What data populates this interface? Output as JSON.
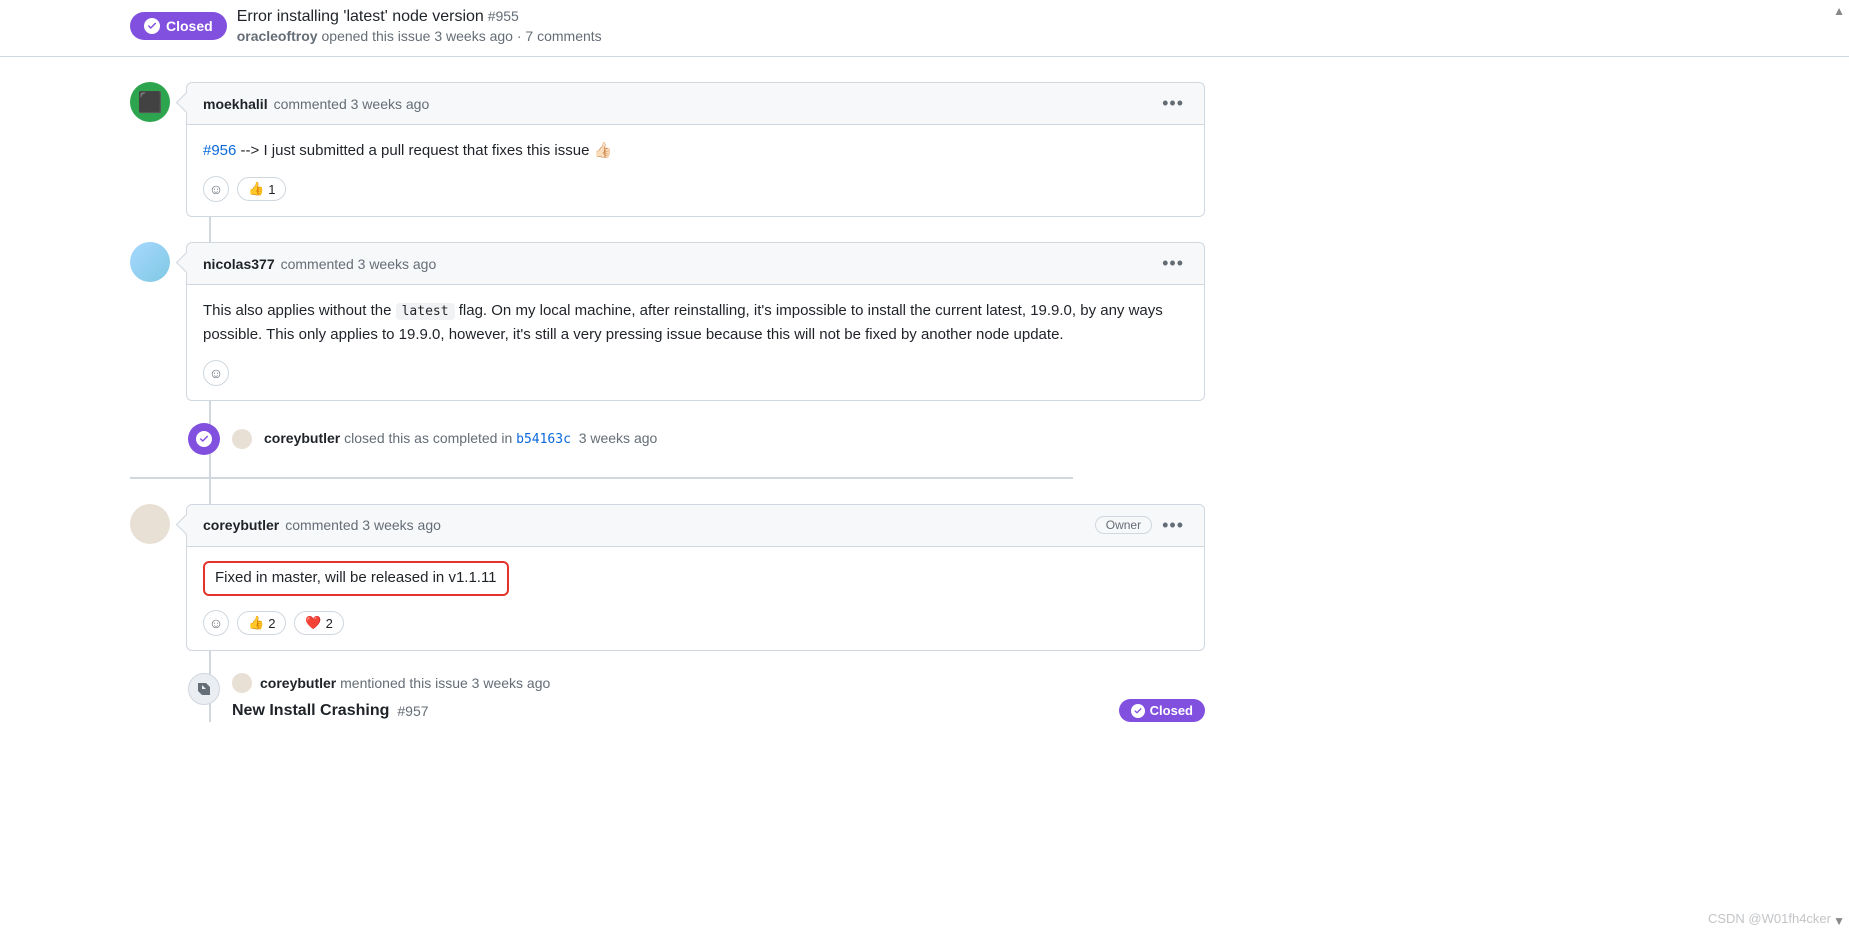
{
  "header": {
    "status": "Closed",
    "title": "Error installing 'latest' node version",
    "number": "#955",
    "author": "oracleoftroy",
    "action": "opened this issue",
    "time": "3 weeks ago",
    "sep": "·",
    "commentcount": "7 comments"
  },
  "comments": [
    {
      "user": "moekhalil",
      "meta": "commented 3 weeks ago",
      "link_ref": "#956",
      "body_after": " --> I just submitted a pull request that fixes this issue 👍🏻",
      "thumb_count": "1"
    },
    {
      "user": "nicolas377",
      "meta": "commented 3 weeks ago",
      "body_pre": "This also applies without the ",
      "code": "latest",
      "body_post": " flag. On my local machine, after reinstalling, it's impossible to install the current latest, 19.9.0, by any ways possible. This only applies to 19.9.0, however, it's still a very pressing issue because this will not be fixed by another node update."
    }
  ],
  "closed_event": {
    "user": "coreybutler",
    "action": "closed this as completed in",
    "sha": "b54163c",
    "time": "3 weeks ago"
  },
  "owner_comment": {
    "user": "coreybutler",
    "meta": "commented 3 weeks ago",
    "owner": "Owner",
    "body": "Fixed in master, will be released in v1.1.11",
    "thumb_count": "2",
    "heart_count": "2"
  },
  "mention_event": {
    "user": "coreybutler",
    "action": "mentioned this issue",
    "time": "3 weeks ago",
    "title": "New Install Crashing",
    "number": "#957",
    "status": "Closed"
  },
  "watermark": "CSDN @W01fh4cker"
}
